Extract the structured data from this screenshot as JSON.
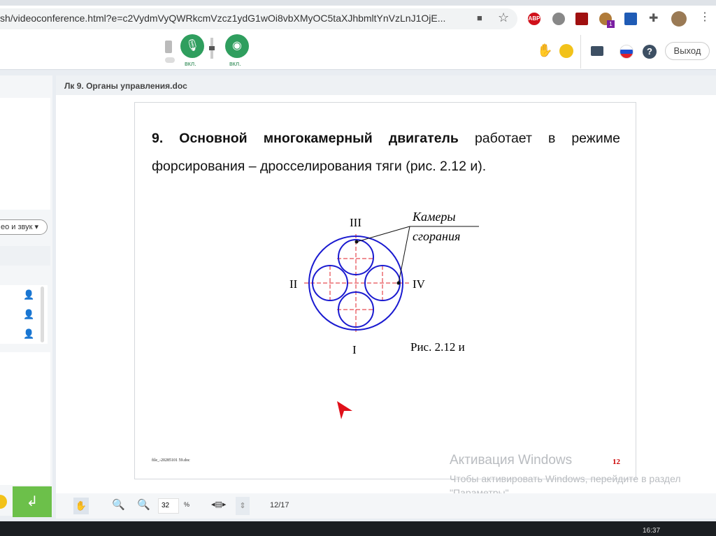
{
  "browser": {
    "url": "sh/videoconference.html?e=c2VydmVyQWRkcmVzcz1ydG1wOi8vbXMyOC5taXJhbmltYnVzLnJ1OjE...",
    "ext_badge": "1",
    "abp_label": "ABP"
  },
  "appbar": {
    "mic_label": "вкл.",
    "cam_label": "вкл.",
    "exit_label": "Выход"
  },
  "left": {
    "dropdown_label": "ео и звук"
  },
  "document": {
    "title": "Лк 9. Органы управления.doc",
    "paragraph_bold": "9. Основной многокамерный двигатель",
    "paragraph_rest": " работает в режиме форсирования – дросселирования тяги (рис. 2.12 и).",
    "figure": {
      "label_top": "III",
      "label_left": "II",
      "label_right": "IV",
      "label_bottom": "I",
      "callout_line1": "Камеры",
      "callout_line2": "сгорания",
      "caption": "Рис. 2.12 и"
    },
    "footer_file": "file_-20285101 59.doc",
    "page_number": "12"
  },
  "toolbar": {
    "zoom_value": "32",
    "zoom_unit": "%",
    "page_indicator": "12/17"
  },
  "watermark": {
    "title": "Активация Windows",
    "text": "Чтобы активировать Windows, перейдите в раздел \"Параметры\"."
  },
  "taskbar": {
    "time": "16:37"
  },
  "colors": {
    "accent_green": "#2f9e5e",
    "send_green": "#6cc04a",
    "diagram_blue": "#1a1ad0",
    "diagram_red": "#e0202a"
  }
}
